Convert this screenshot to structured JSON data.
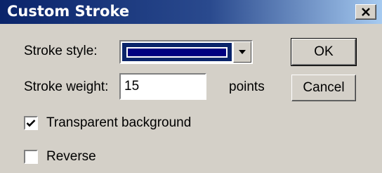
{
  "window": {
    "title": "Custom Stroke",
    "close_icon": "close-x-icon"
  },
  "stroke_style": {
    "label": "Stroke style:",
    "selected_color": "#000080",
    "dropdown_icon": "chevron-down-icon"
  },
  "stroke_weight": {
    "label": "Stroke weight:",
    "value": "15",
    "unit": "points"
  },
  "buttons": {
    "ok": "OK",
    "cancel": "Cancel"
  },
  "options": {
    "transparent_background": {
      "label": "Transparent background",
      "checked": true
    },
    "reverse": {
      "label": "Reverse",
      "checked": false
    }
  },
  "colors": {
    "title_bar_start": "#0a246a",
    "title_bar_end": "#a6caf0",
    "dialog_face": "#d4d0c8"
  }
}
